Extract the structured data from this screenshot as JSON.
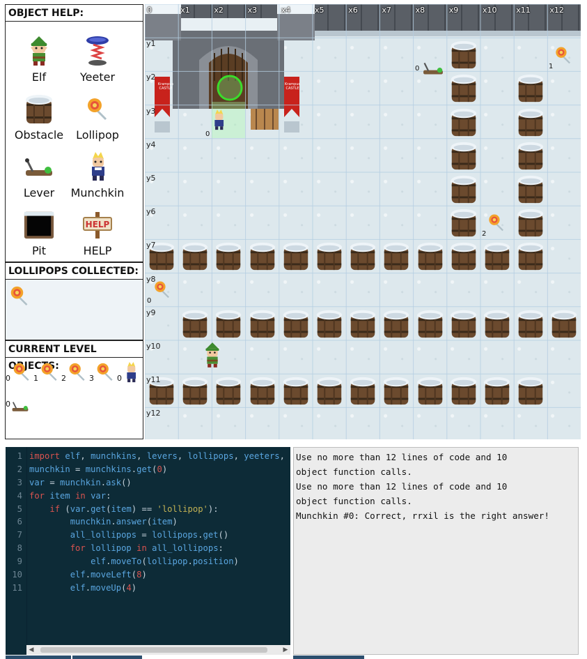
{
  "sidebar": {
    "help_title": "OBJECT HELP:",
    "help_items": [
      {
        "label": "Elf",
        "icon": "elf-icon"
      },
      {
        "label": "Yeeter",
        "icon": "yeeter-icon"
      },
      {
        "label": "Obstacle",
        "icon": "barrel-icon"
      },
      {
        "label": "Lollipop",
        "icon": "lollipop-icon"
      },
      {
        "label": "Lever",
        "icon": "lever-icon"
      },
      {
        "label": "Munchkin",
        "icon": "munchkin-icon"
      },
      {
        "label": "Pit",
        "icon": "pit-icon"
      },
      {
        "label": "HELP",
        "icon": "help-sign-icon"
      }
    ],
    "collected_title": "LOLLIPOPS COLLECTED:",
    "objects_title": "CURRENT LEVEL OBJECTS:",
    "level_objects": [
      {
        "num": "0",
        "icon": "lollipop-icon"
      },
      {
        "num": "1",
        "icon": "lollipop-icon"
      },
      {
        "num": "2",
        "icon": "lollipop-icon"
      },
      {
        "num": "3",
        "icon": "lollipop-icon"
      },
      {
        "num": "0",
        "icon": "munchkin-icon"
      },
      {
        "num": "0",
        "icon": "lever-icon"
      }
    ]
  },
  "game": {
    "x_labels": [
      "0",
      "x1",
      "x2",
      "x3",
      "x4",
      "x5",
      "x6",
      "x7",
      "x8",
      "x9",
      "x10",
      "x11",
      "x12"
    ],
    "y_labels": [
      "y1",
      "y2",
      "y3",
      "y4",
      "y5",
      "y6",
      "y7",
      "y8",
      "y9",
      "y10",
      "y11",
      "y12"
    ],
    "castle_banner_text": "Krampus CASTLE",
    "lever_num": "0",
    "munchkin_num": "0",
    "lollipop_labels": [
      "1",
      "2",
      "0"
    ]
  },
  "editor": {
    "lines": [
      "import elf, munchkins, levers, lollipops, yeeters, pi",
      "munchkin = munchkins.get(0)",
      "var = munchkin.ask()",
      "for item in var:",
      "    if (var.get(item) == 'lollipop'):",
      "        munchkin.answer(item)",
      "        all_lollipops = lollipops.get()",
      "        for lollipop in all_lollipops:",
      "            elf.moveTo(lollipop.position)",
      "        elf.moveLeft(8)",
      "        elf.moveUp(4)"
    ]
  },
  "output": {
    "lines": [
      "Use no more than 12 lines of code and 10",
      "object function calls.",
      "Use no more than 12 lines of code and 10",
      "object function calls.",
      "Munchkin #0: Correct, rrxil is the right answer!"
    ]
  }
}
